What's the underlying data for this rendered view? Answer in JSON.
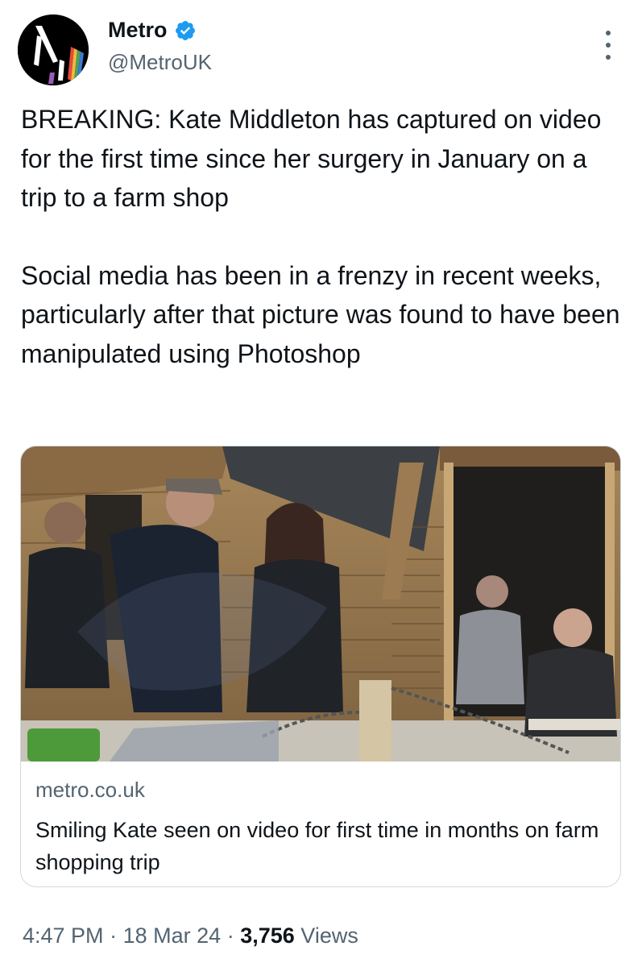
{
  "account": {
    "display_name": "Metro",
    "handle": "@MetroUK",
    "verified": true,
    "verified_icon": "verified-badge-icon",
    "verified_color": "#1d9bf0",
    "avatar_icon": "metro-logo-avatar"
  },
  "tweet": {
    "paragraphs": [
      "BREAKING: Kate Middleton has captured on video for the first time since her surgery in January on a trip to a farm shop",
      "Social media has been in a frenzy in recent weeks, particularly after that picture was found to have been manipulated using Photoshop"
    ],
    "more_icon": "more-options-icon"
  },
  "link_card": {
    "image_icon": "farm-shop-photo",
    "domain": "metro.co.uk",
    "title": "Smiling Kate seen on video for first time in months on farm shopping trip"
  },
  "meta": {
    "time": "4:47 PM",
    "separator": "·",
    "date": "18 Mar 24",
    "views_count": "3,756",
    "views_label": "Views"
  },
  "colors": {
    "text": "#0f1419",
    "secondary": "#536471",
    "border": "#cfd9de",
    "accent": "#1d9bf0"
  }
}
